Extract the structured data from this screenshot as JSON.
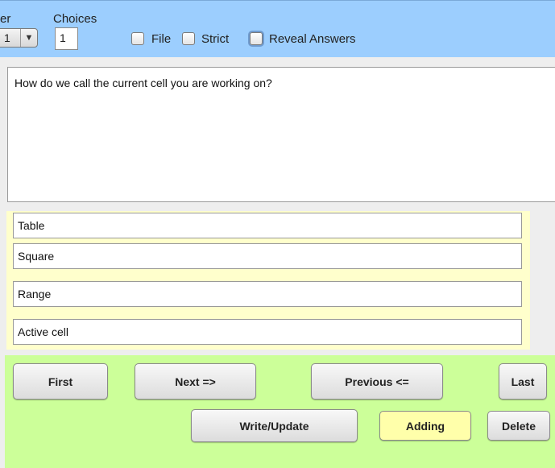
{
  "toolbar": {
    "cut_label": "er",
    "combo_value": "1",
    "choices_label": "Choices",
    "choices_value": "1",
    "file_label": "File",
    "strict_label": "Strict",
    "reveal_label": "Reveal Answers"
  },
  "question": {
    "text": "How do we call the current cell you are working on?"
  },
  "answers": [
    "Table",
    "Square",
    "Range",
    "Active cell"
  ],
  "nav": {
    "first": "First",
    "next": "Next =>",
    "previous": "Previous <=",
    "last": "Last",
    "write_update": "Write/Update",
    "adding": "Adding",
    "delete": "Delete"
  },
  "colors": {
    "toolbar_bg": "#9ccefe",
    "answers_bg": "#ffffcc",
    "nav_bg": "#ccff99",
    "adding_bg": "#ffffaa"
  }
}
